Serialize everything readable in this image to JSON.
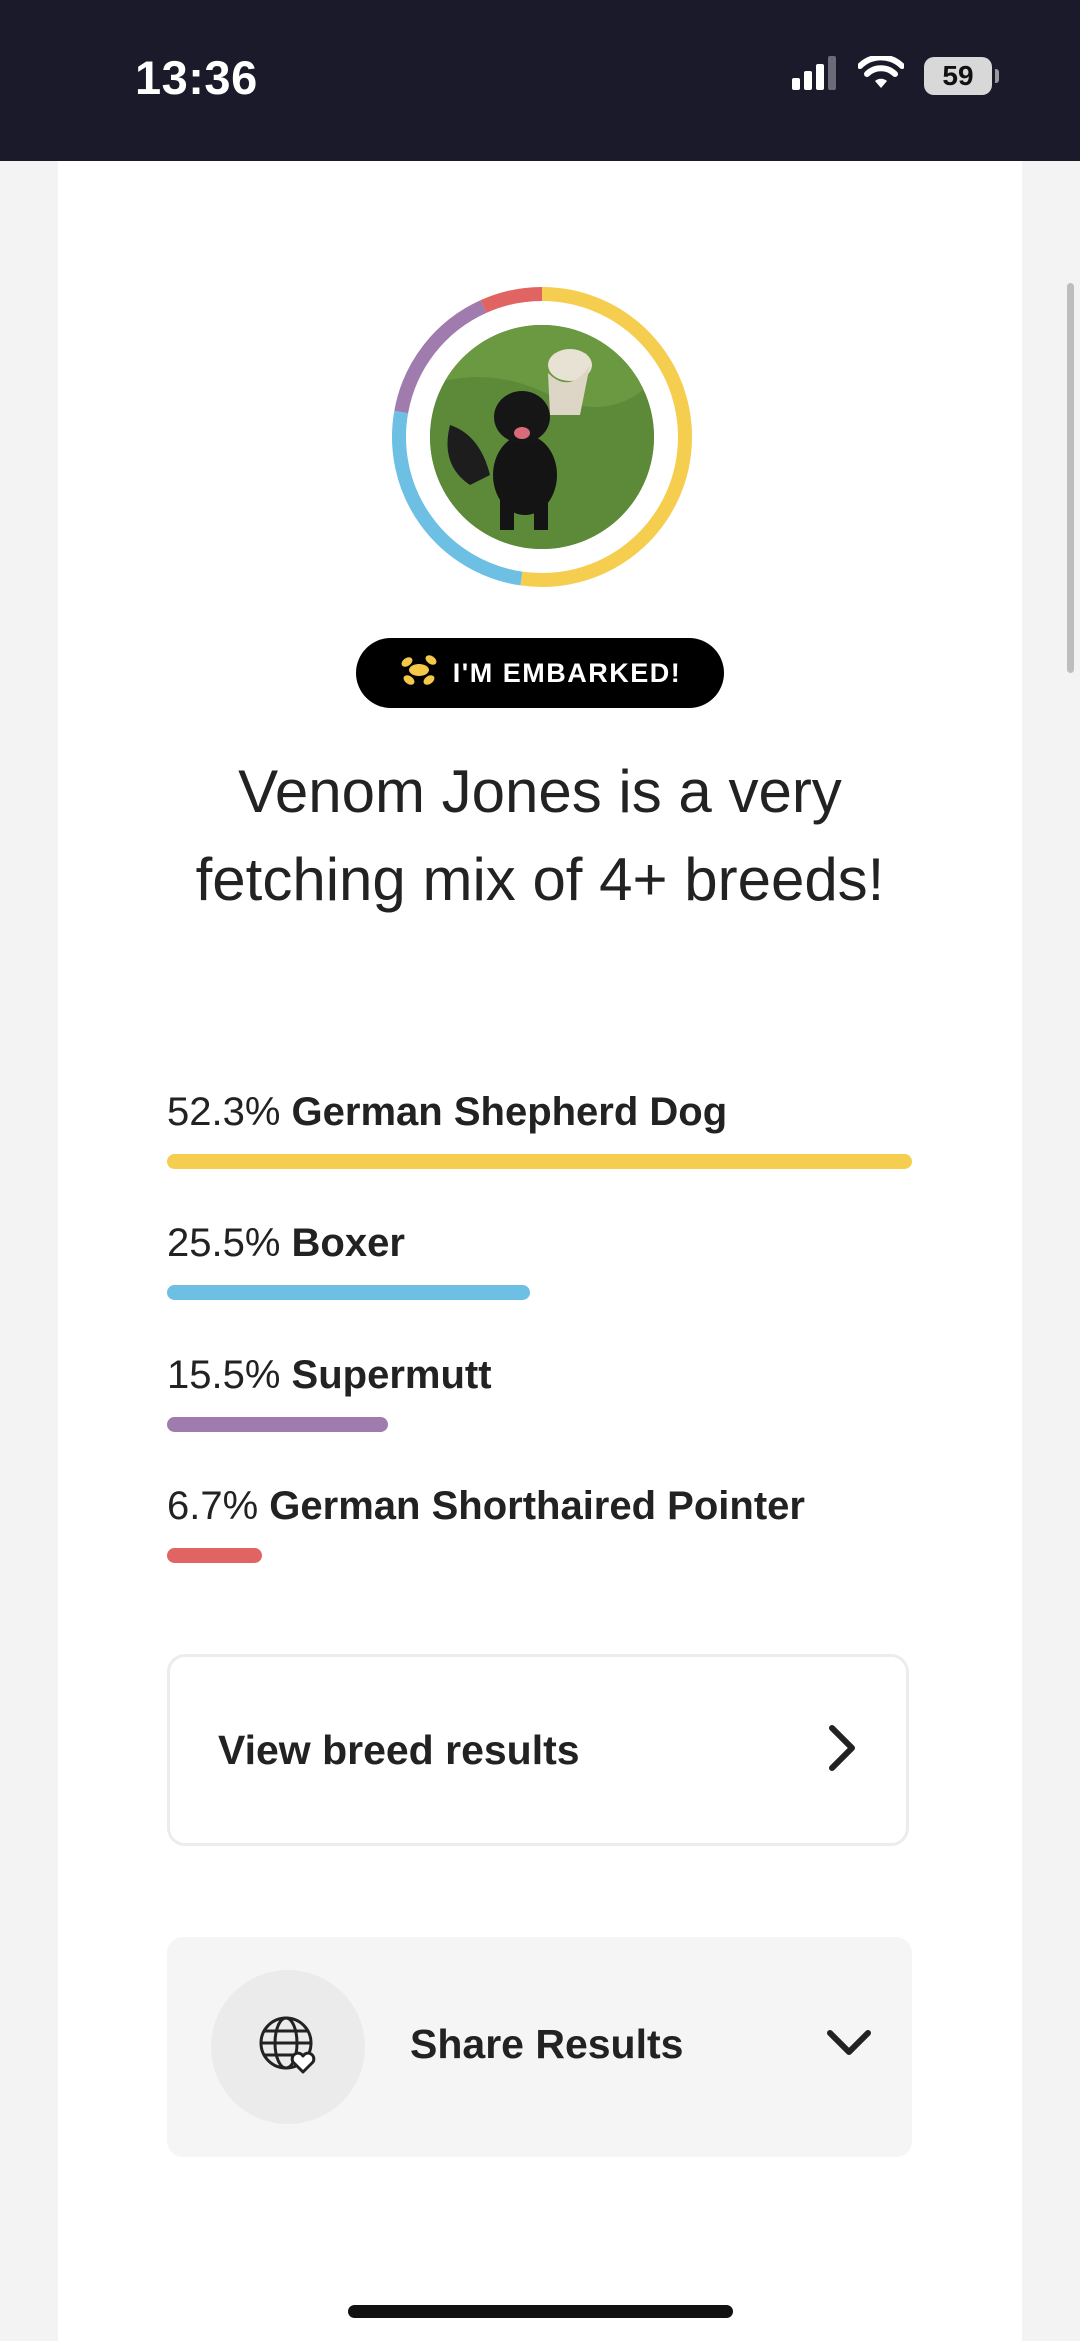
{
  "status_bar": {
    "time": "13:36",
    "battery": "59"
  },
  "badge": {
    "label": "I'M EMBARKED!"
  },
  "headline": "Venom Jones is a very fetching mix of 4+ breeds!",
  "breeds": [
    {
      "percent": "52.3%",
      "name": "German Shepherd Dog",
      "value": 52.3,
      "color": "#f5cd4f"
    },
    {
      "percent": "25.5%",
      "name": "Boxer",
      "value": 25.5,
      "color": "#6dbfe3"
    },
    {
      "percent": "15.5%",
      "name": "Supermutt",
      "value": 15.5,
      "color": "#a07bad"
    },
    {
      "percent": "6.7%",
      "name": "German Shorthaired Pointer",
      "value": 6.7,
      "color": "#e06462"
    }
  ],
  "actions": {
    "view_breed_results": "View breed results",
    "share_results": "Share Results"
  },
  "icons": {
    "badge": "dog-balloon-icon",
    "view": "chevron-right-icon",
    "share": "globe-heart-icon",
    "share_toggle": "chevron-down-icon"
  },
  "colors": {
    "status_bar_bg": "#1b1a2b",
    "card_bg": "#ffffff",
    "badge_bg": "#000000"
  }
}
